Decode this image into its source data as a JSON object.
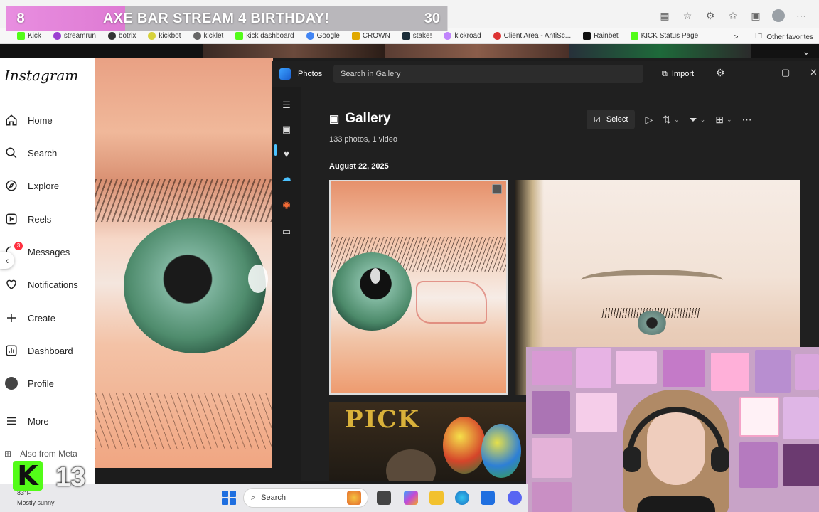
{
  "stream_overlay": {
    "left_count": "8",
    "title": "AXE BAR STREAM 4 BIRTHDAY!",
    "right_count": "30",
    "progress": 0.27
  },
  "bookmarks": [
    "Kick",
    "streamrun",
    "botrix",
    "kickbot",
    "kicklet",
    "kick dashboard",
    "Google",
    "CROWN",
    "stake!",
    "kickroad",
    "Client Area - AntiSc...",
    "Rainbet",
    "KICK Status Page"
  ],
  "bookmarks_overflow": ">",
  "other_favorites": "Other favorites",
  "instagram": {
    "logo": "Instagram",
    "items": [
      {
        "label": "Home",
        "icon": "home-icon"
      },
      {
        "label": "Search",
        "icon": "search-icon"
      },
      {
        "label": "Explore",
        "icon": "compass-icon"
      },
      {
        "label": "Reels",
        "icon": "reels-icon"
      },
      {
        "label": "Messages",
        "icon": "messenger-icon",
        "badge": "3"
      },
      {
        "label": "Notifications",
        "icon": "heart-icon"
      },
      {
        "label": "Create",
        "icon": "plus-icon"
      },
      {
        "label": "Dashboard",
        "icon": "dashboard-icon"
      },
      {
        "label": "Profile",
        "icon": "profile-icon"
      },
      {
        "label": "More",
        "icon": "menu-icon"
      }
    ],
    "also_from_meta": "Also from Meta"
  },
  "photos_app": {
    "app_name": "Photos",
    "search_placeholder": "Search in Gallery",
    "import_label": "Import",
    "heading": "Gallery",
    "subtitle": "133 photos, 1 video",
    "date_group": "August 22, 2025",
    "select_label": "Select",
    "thumb_text": "PICK"
  },
  "kick_overlay": {
    "logo": "K",
    "count": "13"
  },
  "taskbar": {
    "temperature": "83°F",
    "weather": "Mostly sunny",
    "search_label": "Search"
  },
  "colors": {
    "stream_pink": "#de7ad3",
    "kick_green": "#53fc18",
    "photos_bg": "#202020",
    "accent_blue": "#4cc2ff"
  }
}
